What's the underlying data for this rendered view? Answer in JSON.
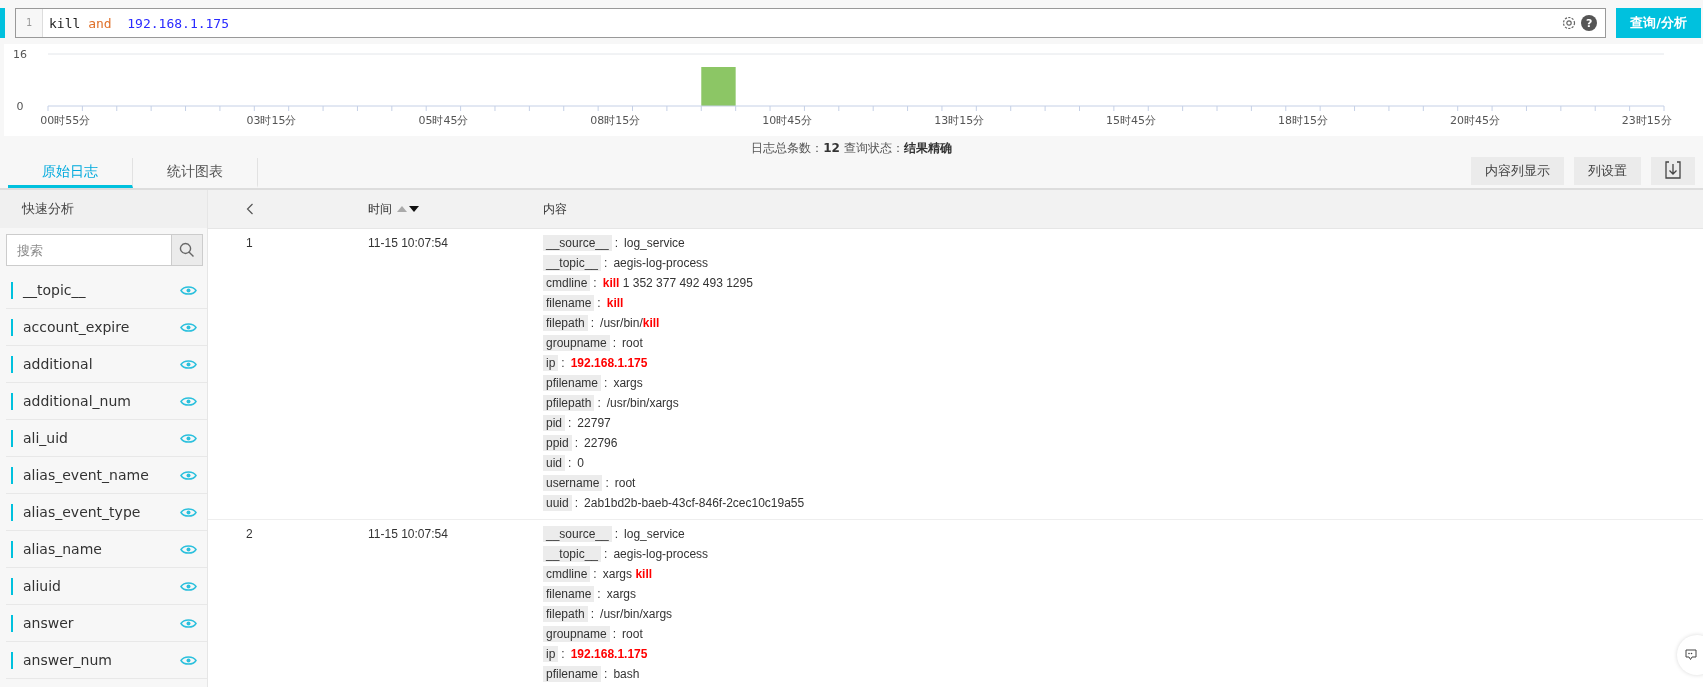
{
  "query": {
    "line_number": "1",
    "tokens": [
      {
        "kind": "term",
        "text": "kill"
      },
      {
        "kind": "operator",
        "text": "and"
      },
      {
        "kind": "ip",
        "text": "192.168.1.175"
      }
    ],
    "help_label": "?",
    "button": "查询/分析"
  },
  "histogram": {
    "time_labels": [
      "00时55分",
      "03时15分",
      "05时45分",
      "08时15分",
      "10时45分",
      "13时15分",
      "15时45分",
      "18时15分",
      "20时45分",
      "23时15分"
    ],
    "chart_data": {
      "type": "bar",
      "yticks": [
        0,
        16
      ],
      "ylim": [
        0,
        16
      ],
      "values": [
        0,
        0,
        0,
        0,
        0,
        0,
        0,
        0,
        0,
        0,
        0,
        0,
        0,
        0,
        0,
        0,
        0,
        0,
        0,
        12,
        0,
        0,
        0,
        0,
        0,
        0,
        0,
        0,
        0,
        0,
        0,
        0,
        0,
        0,
        0,
        0,
        0,
        0,
        0,
        0,
        0,
        0,
        0,
        0,
        0,
        0,
        0
      ]
    }
  },
  "summary": "日志总条数：**12**  查询状态：**结果精确**",
  "tabs": [
    {
      "label": "原始日志",
      "selected": true
    },
    {
      "label": "统计图表",
      "selected": false
    }
  ],
  "toolbar": {
    "buttons": [
      "内容列显示",
      "列设置"
    ]
  },
  "sidebar": {
    "title": "快速分析",
    "search_placeholder": "搜索",
    "fields": [
      "__topic__",
      "account_expire",
      "additional",
      "additional_num",
      "ali_uid",
      "alias_event_name",
      "alias_event_type",
      "alias_name",
      "aliuid",
      "answer",
      "answer_num"
    ]
  },
  "table": {
    "columns": [
      "时间",
      "内容"
    ],
    "rows": [
      {
        "number": "1",
        "time": "11-15 10:07:54",
        "fields": [
          {
            "key": "__source__",
            "separator": ":",
            "value": "log_service",
            "match": false
          },
          {
            "key": "__topic__",
            "separator": ":",
            "value": "aegis-log-process",
            "match": false
          },
          {
            "key": "cmdline",
            "separator": ":",
            "value": "**kill** 1 352 377 492 493 1295",
            "match": false
          },
          {
            "key": "filename",
            "separator": ":",
            "value": "kill",
            "match": true
          },
          {
            "key": "filepath",
            "separator": ":",
            "value": "/usr/bin/**kill**",
            "match": false
          },
          {
            "key": "groupname",
            "separator": ":",
            "value": "root",
            "match": false
          },
          {
            "key": "ip",
            "separator": ":",
            "value": "192.168.1.175",
            "match": true
          },
          {
            "key": "pfilename",
            "separator": ":",
            "value": "xargs",
            "match": false
          },
          {
            "key": "pfilepath",
            "separator": ":",
            "value": "/usr/bin/xargs",
            "match": false
          },
          {
            "key": "pid",
            "separator": ":",
            "value": "22797",
            "match": false
          },
          {
            "key": "ppid",
            "separator": ":",
            "value": "22796",
            "match": false
          },
          {
            "key": "uid",
            "separator": ":",
            "value": "0",
            "match": false
          },
          {
            "key": "username",
            "separator": ":",
            "value": "root",
            "match": false
          },
          {
            "key": "uuid",
            "separator": ":",
            "value": "2ab1bd2b-baeb-43cf-846f-2cec10c19a55",
            "match": false
          }
        ]
      },
      {
        "number": "2",
        "time": "11-15 10:07:54",
        "fields": [
          {
            "key": "__source__",
            "separator": ":",
            "value": "log_service",
            "match": false
          },
          {
            "key": "__topic__",
            "separator": ":",
            "value": "aegis-log-process",
            "match": false
          },
          {
            "key": "cmdline",
            "separator": ":",
            "value": "xargs **kill**",
            "match": false
          },
          {
            "key": "filename",
            "separator": ":",
            "value": "xargs",
            "match": false
          },
          {
            "key": "filepath",
            "separator": ":",
            "value": "/usr/bin/xargs",
            "match": false
          },
          {
            "key": "groupname",
            "separator": ":",
            "value": "root",
            "match": false
          },
          {
            "key": "ip",
            "separator": ":",
            "value": "192.168.1.175",
            "match": true
          },
          {
            "key": "pfilename",
            "separator": ":",
            "value": "bash",
            "match": false
          }
        ]
      }
    ]
  }
}
